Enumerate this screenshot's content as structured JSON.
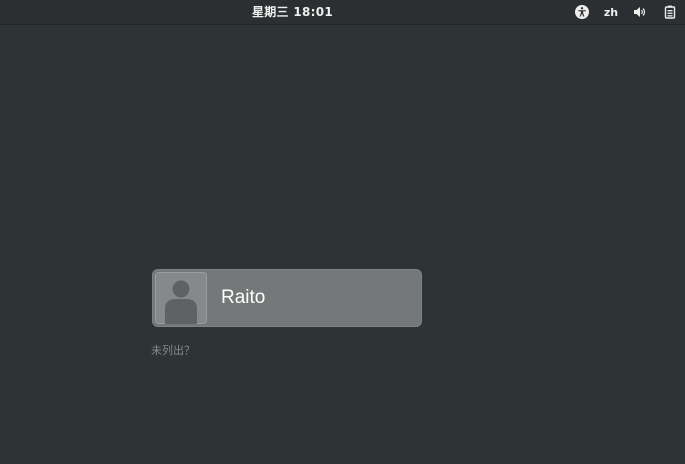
{
  "top_bar": {
    "clock": "星期三 18:01",
    "input_language": "zh",
    "icons": [
      "accessibility-icon",
      "volume-icon",
      "power-icon"
    ]
  },
  "login": {
    "username": "Raito",
    "not_listed_link": "未列出？"
  },
  "colors": {
    "background": "#2e3436",
    "card": "#757878",
    "text": "#eeeeec"
  }
}
